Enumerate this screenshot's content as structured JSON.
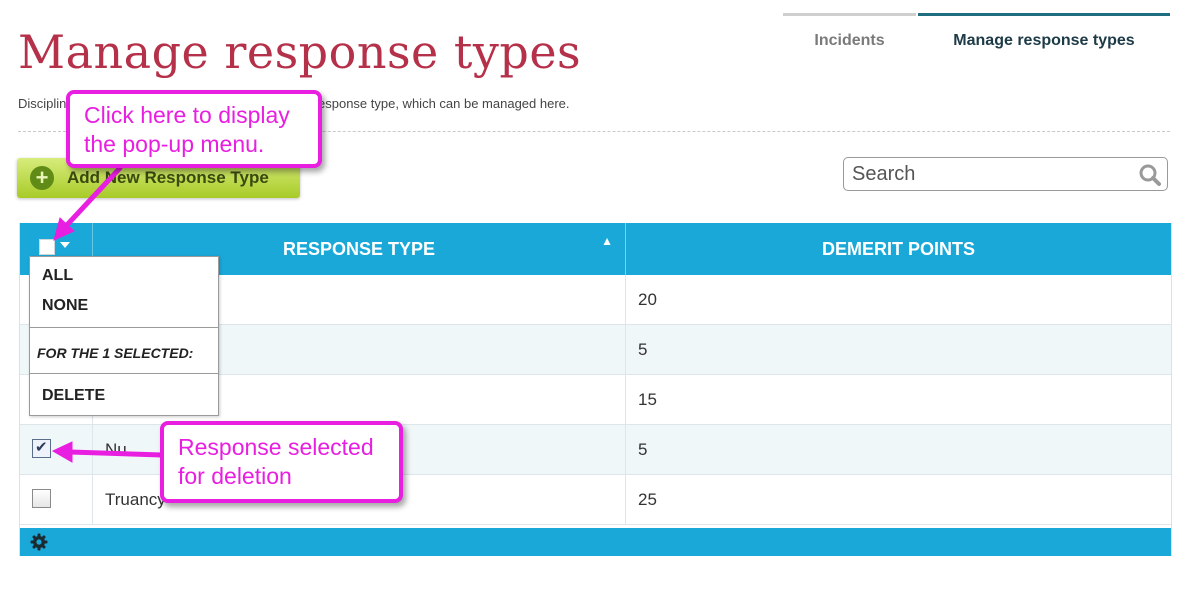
{
  "page": {
    "title": "Manage response types",
    "subtitle_left": "Disciplin",
    "subtitle_right": "esponse type, which can be managed here."
  },
  "tabs": [
    {
      "label": "Incidents",
      "active": false
    },
    {
      "label": "Manage response types",
      "active": true
    }
  ],
  "toolbar": {
    "add_label": "Add New Response Type",
    "add_icon": "plus-circle-icon"
  },
  "search": {
    "placeholder": "Search",
    "icon": "search-icon"
  },
  "grid": {
    "columns": [
      "RESPONSE TYPE",
      "DEMERIT POINTS"
    ],
    "sort_icon": "sort-asc-icon",
    "rows": [
      {
        "type": "",
        "points": "20",
        "checked": false
      },
      {
        "type": "",
        "points": "5",
        "checked": false
      },
      {
        "type": "",
        "points": "15",
        "checked": false
      },
      {
        "type": "Nu",
        "points": "5",
        "checked": true
      },
      {
        "type": "Truancy",
        "points": "25",
        "checked": false
      }
    ],
    "footer_icon": "gear-icon"
  },
  "popup_menu": {
    "all": "ALL",
    "none": "NONE",
    "caption": "FOR THE 1 SELECTED:",
    "delete": "DELETE"
  },
  "callouts": {
    "top_line1": "Click here to display",
    "top_line2": "the pop-up menu.",
    "bottom_line1": "Response selected",
    "bottom_line2": "for deletion"
  },
  "colors": {
    "title": "#b5314a",
    "header": "#1aa8d8",
    "accent_button": "#a8cb28",
    "callout": "#e81ee0",
    "active_tab": "#1f6e80"
  }
}
